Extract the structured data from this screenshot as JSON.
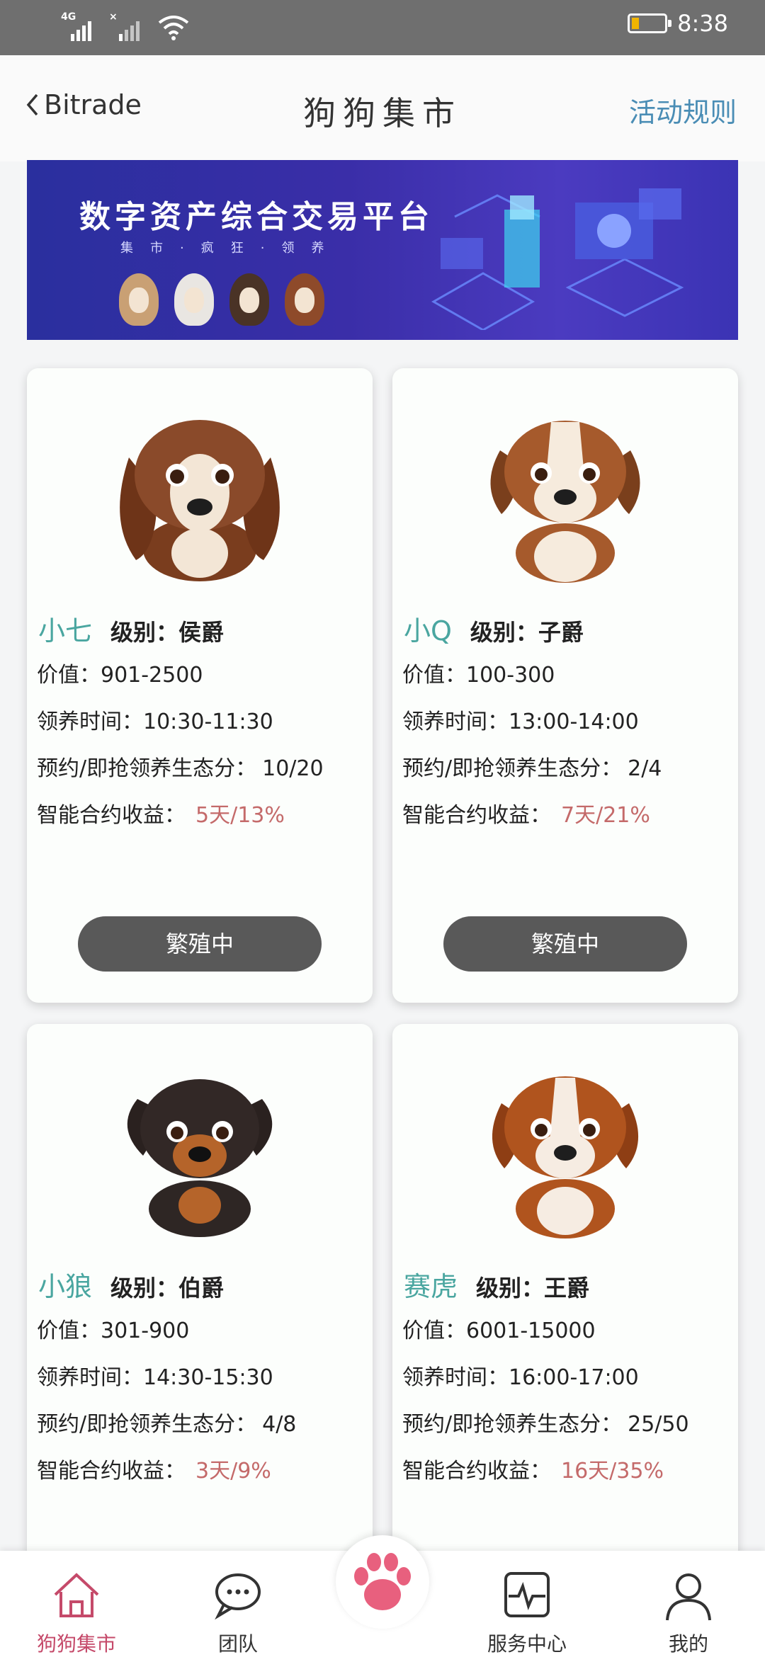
{
  "status_bar": {
    "signal1_label": "4G",
    "signal2_label": "×",
    "battery_icon": "battery-low-icon",
    "time": "8:38"
  },
  "header": {
    "back_label": "Bitrade",
    "title": "狗狗集市",
    "rules_label": "活动规则"
  },
  "banner": {
    "title": "数字资产综合交易平台",
    "subtitle": "集市·疯狂·领养"
  },
  "labels": {
    "value": "价值：",
    "adopt_time": "领养时间：",
    "eco_score": "预约/即抢领养生态分：",
    "profit": "智能合约收益："
  },
  "cards": [
    {
      "name": "小七",
      "level": "级别：侯爵",
      "value": "901-2500",
      "adopt_time": "10:30-11:30",
      "eco_score": "10/20",
      "profit": "5天/13%",
      "button": "繁殖中",
      "dog_colors": {
        "fur": "#8a4a2a",
        "ear": "#6e3418",
        "face": "#f3e6d6"
      }
    },
    {
      "name": "小Q",
      "level": "级别：子爵",
      "value": "100-300",
      "adopt_time": "13:00-14:00",
      "eco_score": "2/4",
      "profit": "7天/21%",
      "button": "繁殖中",
      "dog_colors": {
        "fur": "#a65a2c",
        "ear": "#7a3f1c",
        "face": "#f6ebdd"
      }
    },
    {
      "name": "小狼",
      "level": "级别：伯爵",
      "value": "301-900",
      "adopt_time": "14:30-15:30",
      "eco_score": "4/8",
      "profit": "3天/9%"
    },
    {
      "name": "赛虎",
      "level": "级别：王爵",
      "value": "6001-15000",
      "adopt_time": "16:00-17:00",
      "eco_score": "25/50",
      "profit": "16天/35%"
    }
  ],
  "nav": {
    "items": [
      {
        "label": "狗狗集市",
        "icon": "home-icon",
        "active": true
      },
      {
        "label": "团队",
        "icon": "chat-bubble-icon"
      },
      {
        "label": "",
        "icon": "paw-icon"
      },
      {
        "label": "服务中心",
        "icon": "heartbeat-icon"
      },
      {
        "label": "我的",
        "icon": "person-icon"
      }
    ]
  },
  "colors": {
    "accent": "#4aa6a0",
    "profit": "#c46a6a",
    "active_tab": "#c54a6a",
    "paw": "#e8607e",
    "button": "#595959"
  }
}
